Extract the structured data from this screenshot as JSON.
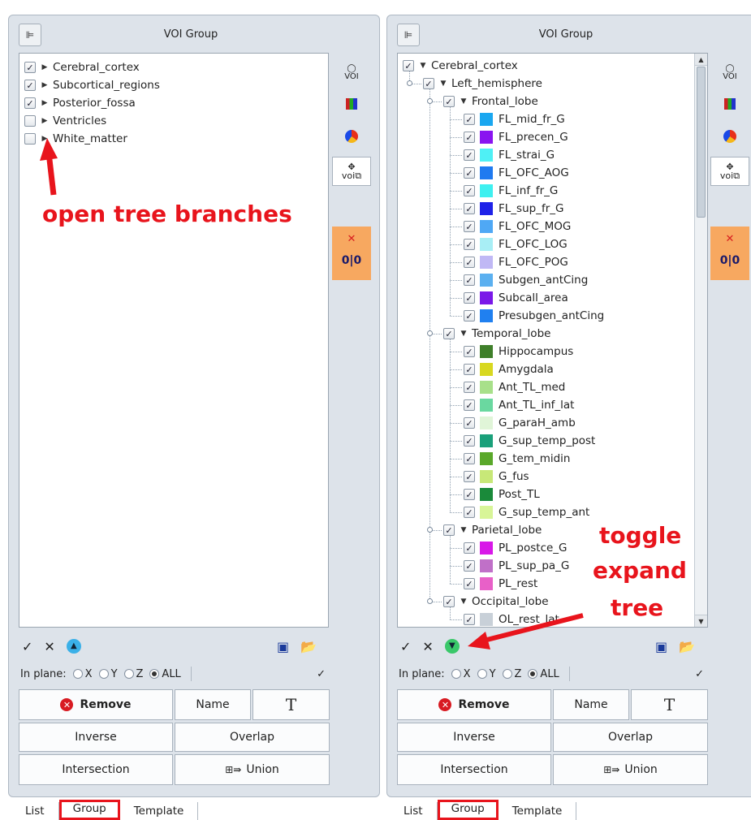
{
  "left_panel": {
    "title": "VOI Group",
    "tree": [
      {
        "label": "Cerebral_cortex",
        "checked": true
      },
      {
        "label": "Subcortical_regions",
        "checked": true
      },
      {
        "label": "Posterior_fossa",
        "checked": true
      },
      {
        "label": "Ventricles",
        "checked": false
      },
      {
        "label": "White_matter",
        "checked": false
      }
    ],
    "annotation": "open tree branches"
  },
  "right_panel": {
    "title": "VOI Group",
    "tree": [
      {
        "label": "Cerebral_cortex",
        "level": 0,
        "type": "group",
        "checked": true
      },
      {
        "label": "Left_hemisphere",
        "level": 1,
        "type": "group",
        "checked": true
      },
      {
        "label": "Frontal_lobe",
        "level": 2,
        "type": "group",
        "checked": true
      },
      {
        "label": "FL_mid_fr_G",
        "level": 3,
        "color": "#1aa7f0",
        "checked": true
      },
      {
        "label": "FL_precen_G",
        "level": 3,
        "color": "#8a14f0",
        "checked": true
      },
      {
        "label": "FL_strai_G",
        "level": 3,
        "color": "#4ff0f5",
        "checked": true
      },
      {
        "label": "FL_OFC_AOG",
        "level": 3,
        "color": "#1f7af0",
        "checked": true
      },
      {
        "label": "FL_inf_fr_G",
        "level": 3,
        "color": "#3ef0f0",
        "checked": true
      },
      {
        "label": "FL_sup_fr_G",
        "level": 3,
        "color": "#1e22e8",
        "checked": true
      },
      {
        "label": "FL_OFC_MOG",
        "level": 3,
        "color": "#4fa8f5",
        "checked": true
      },
      {
        "label": "FL_OFC_LOG",
        "level": 3,
        "color": "#a8eef5",
        "checked": true
      },
      {
        "label": "FL_OFC_POG",
        "level": 3,
        "color": "#c0b8f5",
        "checked": true
      },
      {
        "label": "Subgen_antCing",
        "level": 3,
        "color": "#5bb0f0",
        "checked": true
      },
      {
        "label": "Subcall_area",
        "level": 3,
        "color": "#7a18e8",
        "checked": true
      },
      {
        "label": "Presubgen_antCing",
        "level": 3,
        "color": "#2080f0",
        "checked": true
      },
      {
        "label": "Temporal_lobe",
        "level": 2,
        "type": "group",
        "checked": true
      },
      {
        "label": "Hippocampus",
        "level": 3,
        "color": "#3f7f2a",
        "checked": true
      },
      {
        "label": "Amygdala",
        "level": 3,
        "color": "#d8d820",
        "checked": true
      },
      {
        "label": "Ant_TL_med",
        "level": 3,
        "color": "#a8e08a",
        "checked": true
      },
      {
        "label": "Ant_TL_inf_lat",
        "level": 3,
        "color": "#6ad8a0",
        "checked": true
      },
      {
        "label": "G_paraH_amb",
        "level": 3,
        "color": "#e0f5d8",
        "checked": true
      },
      {
        "label": "G_sup_temp_post",
        "level": 3,
        "color": "#1aa07a",
        "checked": true
      },
      {
        "label": "G_tem_midin",
        "level": 3,
        "color": "#5aa82a",
        "checked": true
      },
      {
        "label": "G_fus",
        "level": 3,
        "color": "#c8e878",
        "checked": true
      },
      {
        "label": "Post_TL",
        "level": 3,
        "color": "#1a8a3a",
        "checked": true
      },
      {
        "label": "G_sup_temp_ant",
        "level": 3,
        "color": "#d8f598",
        "checked": true
      },
      {
        "label": "Parietal_lobe",
        "level": 2,
        "type": "group",
        "checked": true
      },
      {
        "label": "PL_postce_G",
        "level": 3,
        "color": "#d818e8",
        "checked": true
      },
      {
        "label": "PL_sup_pa_G",
        "level": 3,
        "color": "#c070c8",
        "checked": true
      },
      {
        "label": "PL_rest",
        "level": 3,
        "color": "#e860c8",
        "checked": true
      },
      {
        "label": "Occipital_lobe",
        "level": 2,
        "type": "group",
        "checked": true
      },
      {
        "label": "OL_rest_lat",
        "level": 3,
        "color": "#c8d0d8",
        "checked": true
      }
    ],
    "annotation_lines": [
      "toggle",
      "expand",
      "tree"
    ]
  },
  "controls": {
    "in_plane_label": "In plane:",
    "radios": [
      "X",
      "Y",
      "Z",
      "ALL"
    ],
    "selected_radio": "ALL",
    "remove": "Remove",
    "name": "Name",
    "font_btn": "T",
    "inverse": "Inverse",
    "overlap": "Overlap",
    "intersection": "Intersection",
    "union": "Union"
  },
  "tabs": [
    "List",
    "Group",
    "Template"
  ],
  "selected_tab": "Group",
  "colors": {
    "accent_red": "#e8141c",
    "panel_bg": "#dde3ea",
    "side_orange": "#f7a860"
  }
}
